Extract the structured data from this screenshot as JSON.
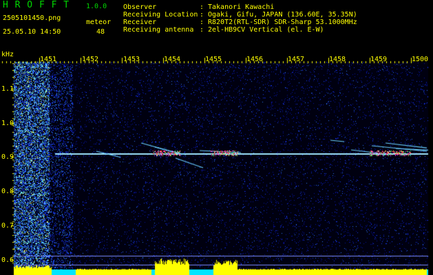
{
  "app": {
    "title": "H R O F F T",
    "version": "1.0.0",
    "filename": "2505101450.png",
    "datetime": "25.05.10 14:50",
    "counter_label": "meteor",
    "counter_value": "48"
  },
  "station": [
    {
      "key": "Observer",
      "value": "Takanori Kawachi"
    },
    {
      "key": "Receiving Location",
      "value": "Ogaki, Gifu, JAPAN (136.60E, 35.35N)"
    },
    {
      "key": "Receiver",
      "value": "R820T2(RTL-SDR) SDR-Sharp 53.1000MHz"
    },
    {
      "key": "Receiving antenna",
      "value": "2el-HB9CV Vertical (el. E-W)"
    }
  ],
  "separator": ":",
  "axis": {
    "y_unit": "kHz",
    "y_ticks": [
      "1.1",
      "1.0",
      "0.9",
      "0.8",
      "0.7",
      "0.6"
    ],
    "x_ticks": [
      "1451",
      "1452",
      "1453",
      "1454",
      "1455",
      "1456",
      "1457",
      "1458",
      "1459",
      "1500"
    ]
  },
  "colors": {
    "background": "#000000",
    "axis": "#ffff00",
    "title": "#00d800",
    "carrier": "#9fe8ff",
    "noise": "#1a2cff",
    "hot": "#ff3030",
    "floor": "#00e5ff"
  }
}
